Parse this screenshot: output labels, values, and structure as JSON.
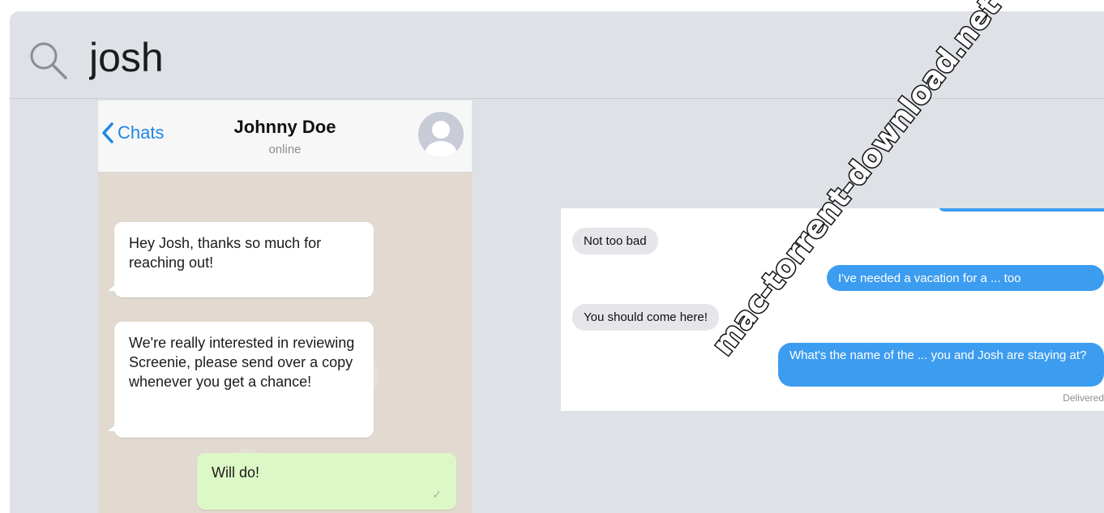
{
  "search": {
    "query": "josh"
  },
  "chat_preview": {
    "back_label": "Chats",
    "contact_name": "Johnny Doe",
    "contact_status": "online",
    "messages": [
      {
        "direction": "in",
        "text": "Hey Josh, thanks so much for reaching out!"
      },
      {
        "direction": "in",
        "text": "We're really interested in reviewing Screenie, please send over a copy whenever you get a chance!"
      },
      {
        "direction": "out",
        "text": "Will do!"
      }
    ]
  },
  "imessage_preview": {
    "messages": [
      {
        "direction": "in",
        "text": "Not too bad"
      },
      {
        "direction": "out",
        "text": "I've needed a vacation for a ... too"
      },
      {
        "direction": "in",
        "text": "You should come here!"
      },
      {
        "direction": "out",
        "text": "What's the name of the ... you and Josh are staying at?"
      }
    ],
    "delivered_label": "Delivered"
  },
  "watermark": {
    "text": "mac-torrent-download.net"
  },
  "colors": {
    "frame_bg": "#dee1e6",
    "whatsapp_out": "#dcf8c6",
    "imessage_blue": "#3c9cf0",
    "imessage_gray": "#e5e5ea",
    "link_blue": "#1f87e6"
  }
}
